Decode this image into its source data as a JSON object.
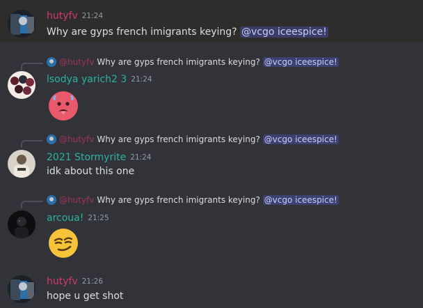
{
  "colors": {
    "background": "#313338",
    "highlight_row": "#2e2d2b",
    "name_hutyfv": "#d13a6d",
    "name_lsodya": "#2bb2a0",
    "name_stormyrite": "#2bb2a0",
    "name_arcoua": "#2bb2a0",
    "mention_bg": "#3c4270",
    "mention_text": "#c9cdfb"
  },
  "messages": [
    {
      "username": "hutyfv",
      "time": "21:24",
      "text": "Why are gyps french imigrants keying? ",
      "mention": "@vcgo iceespice!",
      "avatar": "avatar-hutyfv"
    },
    {
      "reply": {
        "username": "@hutyfv",
        "text": "Why are gyps french imigrants keying? ",
        "mention": "@vcgo iceespice!"
      },
      "username": "lsodya yarich2 3",
      "time": "21:24",
      "emoji": "hot-face-sweat-emoji",
      "avatar": "avatar-lsodya"
    },
    {
      "reply": {
        "username": "@hutyfv",
        "text": "Why are gyps french imigrants keying? ",
        "mention": "@vcgo iceespice!"
      },
      "username": "2021 Stormyrite",
      "time": "21:24",
      "text": "idk about this one",
      "avatar": "avatar-stormyrite"
    },
    {
      "reply": {
        "username": "@hutyfv",
        "text": "Why are gyps french imigrants keying? ",
        "mention": "@vcgo iceespice!"
      },
      "username": "arcoua!",
      "time": "21:25",
      "emoji": "smirking-face-emoji",
      "avatar": "avatar-arcoua"
    },
    {
      "username": "hutyfv",
      "time": "21:26",
      "text": "hope u get shot",
      "avatar": "avatar-hutyfv"
    }
  ]
}
